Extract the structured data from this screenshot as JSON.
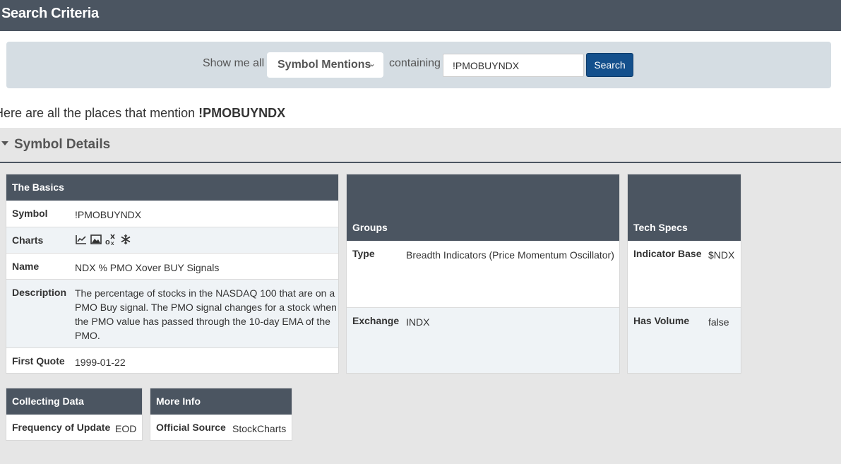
{
  "header": {
    "title": "Search Criteria"
  },
  "search": {
    "show_label": "Show me all",
    "select_value": "Symbol Mentions",
    "containing_label": "containing",
    "query": "!PMOBUYNDX",
    "button_label": "Search"
  },
  "results": {
    "intro": "Here are all the places that mention ",
    "symbol": "!PMOBUYNDX"
  },
  "section": {
    "title": "Symbol Details"
  },
  "basics": {
    "title": "The Basics",
    "symbol_label": "Symbol",
    "symbol_value": "!PMOBUYNDX",
    "charts_label": "Charts",
    "chart_icons": [
      "line-chart-icon",
      "image-chart-icon",
      "seasonality-icon",
      "snowflake-icon"
    ],
    "name_label": "Name",
    "name_value": "NDX % PMO Xover BUY Signals",
    "description_label": "Description",
    "description_lines": [
      "The percentage of stocks in the NASDAQ 100 that are on a",
      "PMO Buy signal. The PMO signal changes for a stock when",
      "the PMO value has passed through the 10-day EMA of the",
      "PMO."
    ],
    "first_quote_label": "First Quote",
    "first_quote_value": "1999-01-22"
  },
  "groups": {
    "title": "Groups",
    "type_label": "Type",
    "type_value": "Breadth Indicators (Price Momentum Oscillator)",
    "exchange_label": "Exchange",
    "exchange_value": "INDX"
  },
  "techspecs": {
    "title": "Tech Specs",
    "base_label": "Indicator Base",
    "base_value": "$NDX",
    "volume_label": "Has Volume",
    "volume_value": "false"
  },
  "collecting": {
    "title": "Collecting Data",
    "freq_label": "Frequency of Update",
    "freq_value": "EOD"
  },
  "moreinfo": {
    "title": "More Info",
    "source_label": "Official Source",
    "source_value": "StockCharts"
  },
  "colors": {
    "header_bg": "#4b5561",
    "button_bg": "#14508c",
    "criteria_bg": "#d5dde3",
    "alt_row": "#eff3f6"
  }
}
